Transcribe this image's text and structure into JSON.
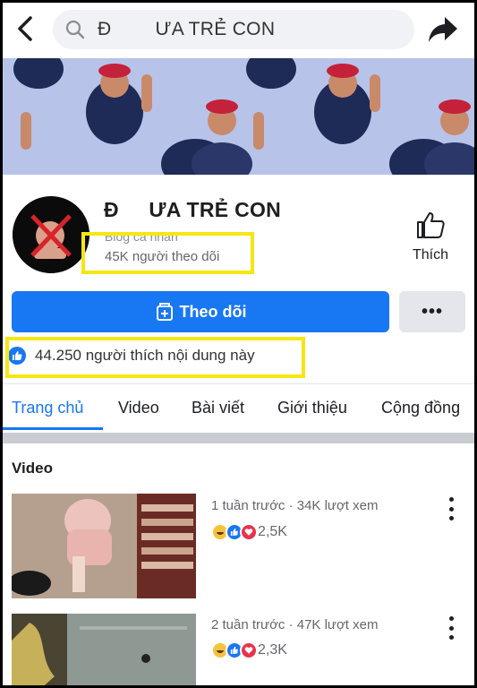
{
  "header": {
    "search_text": "Đ        ƯA TRẺ CON"
  },
  "page": {
    "name": "Đ     ƯA TRẺ CON",
    "category": "Blog cá nhân",
    "followers": "45K người theo dõi",
    "like_label": "Thích",
    "follow_label": "Theo dõi",
    "more_label": "•••",
    "likes_text": "44.250 người thích nội dung này"
  },
  "tabs": [
    {
      "label": "Trang chủ"
    },
    {
      "label": "Video"
    },
    {
      "label": "Bài viết"
    },
    {
      "label": "Giới thiệu"
    },
    {
      "label": "Cộng đồng"
    }
  ],
  "videos": {
    "title": "Video",
    "items": [
      {
        "meta": "1 tuần trước · 34K lượt xem",
        "reactions": "2,5K"
      },
      {
        "meta": "2 tuần trước · 47K lượt xem",
        "reactions": "2,3K"
      }
    ]
  },
  "colors": {
    "accent": "#1877f2",
    "highlight": "#f6e613",
    "cover": "#b7c3e9"
  }
}
